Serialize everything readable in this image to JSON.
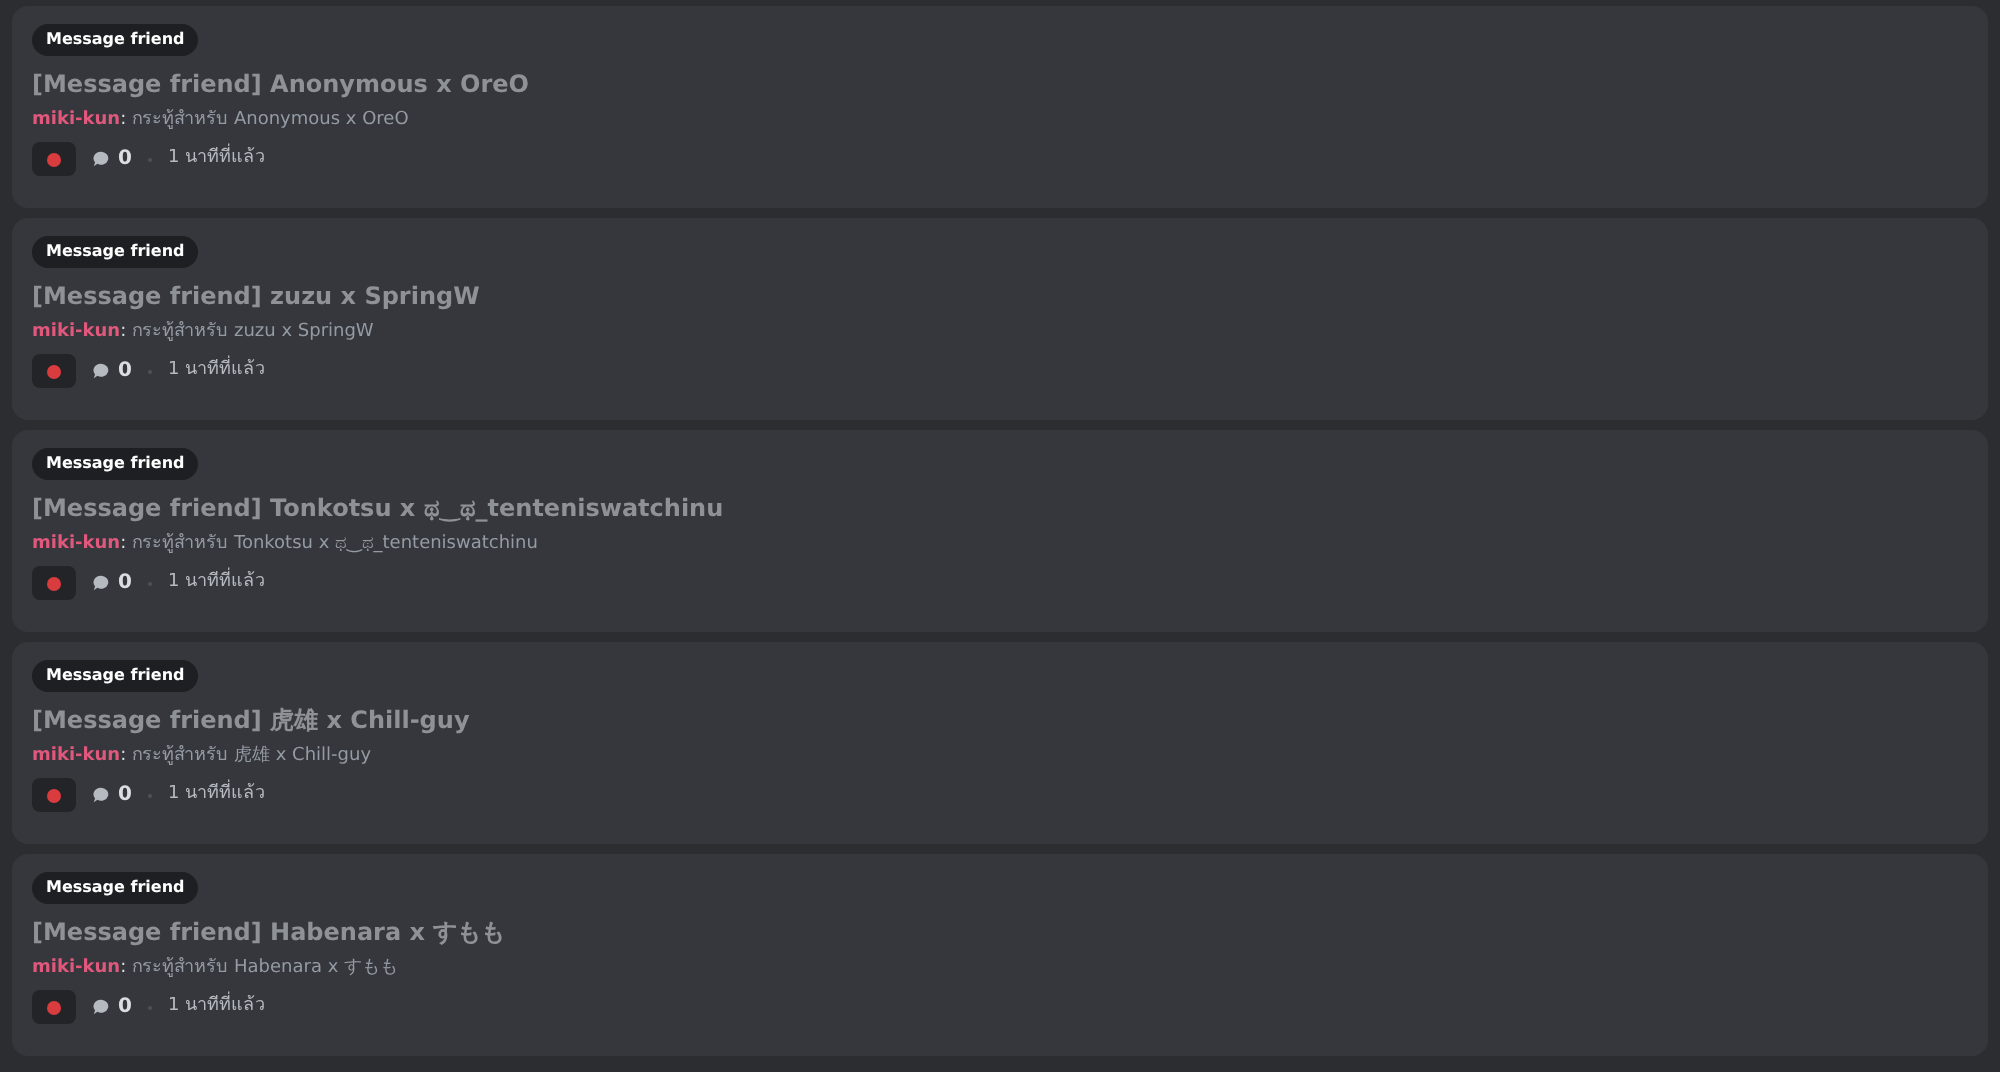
{
  "posts": [
    {
      "tag": "Message friend",
      "title": "[Message friend] Anonymous x OreO",
      "author": "miki-kun",
      "separator": ":",
      "message": "กระทู้สำหรับ Anonymous x OreO",
      "comments": "0",
      "time": "1 นาทีที่แล้ว"
    },
    {
      "tag": "Message friend",
      "title": "[Message friend] zuzu x SpringW",
      "author": "miki-kun",
      "separator": ":",
      "message": "กระทู้สำหรับ zuzu x SpringW",
      "comments": "0",
      "time": "1 นาทีที่แล้ว"
    },
    {
      "tag": "Message friend",
      "title": "[Message friend] Tonkotsu x ಥ‿ಥ_tenteniswatchinu",
      "author": "miki-kun",
      "separator": ":",
      "message": "กระทู้สำหรับ Tonkotsu x ಥ‿ಥ_tenteniswatchinu",
      "comments": "0",
      "time": "1 นาทีที่แล้ว"
    },
    {
      "tag": "Message friend",
      "title": "[Message friend] 虎雄 x Chill-guy",
      "author": "miki-kun",
      "separator": ":",
      "message": "กระทู้สำหรับ 虎雄 x Chill-guy",
      "comments": "0",
      "time": "1 นาทีที่แล้ว"
    },
    {
      "tag": "Message friend",
      "title": "[Message friend] Habenara x すもも",
      "author": "miki-kun",
      "separator": ":",
      "message": "กระทู้สำหรับ Habenara x すもも",
      "comments": "0",
      "time": "1 นาทีที่แล้ว"
    }
  ]
}
